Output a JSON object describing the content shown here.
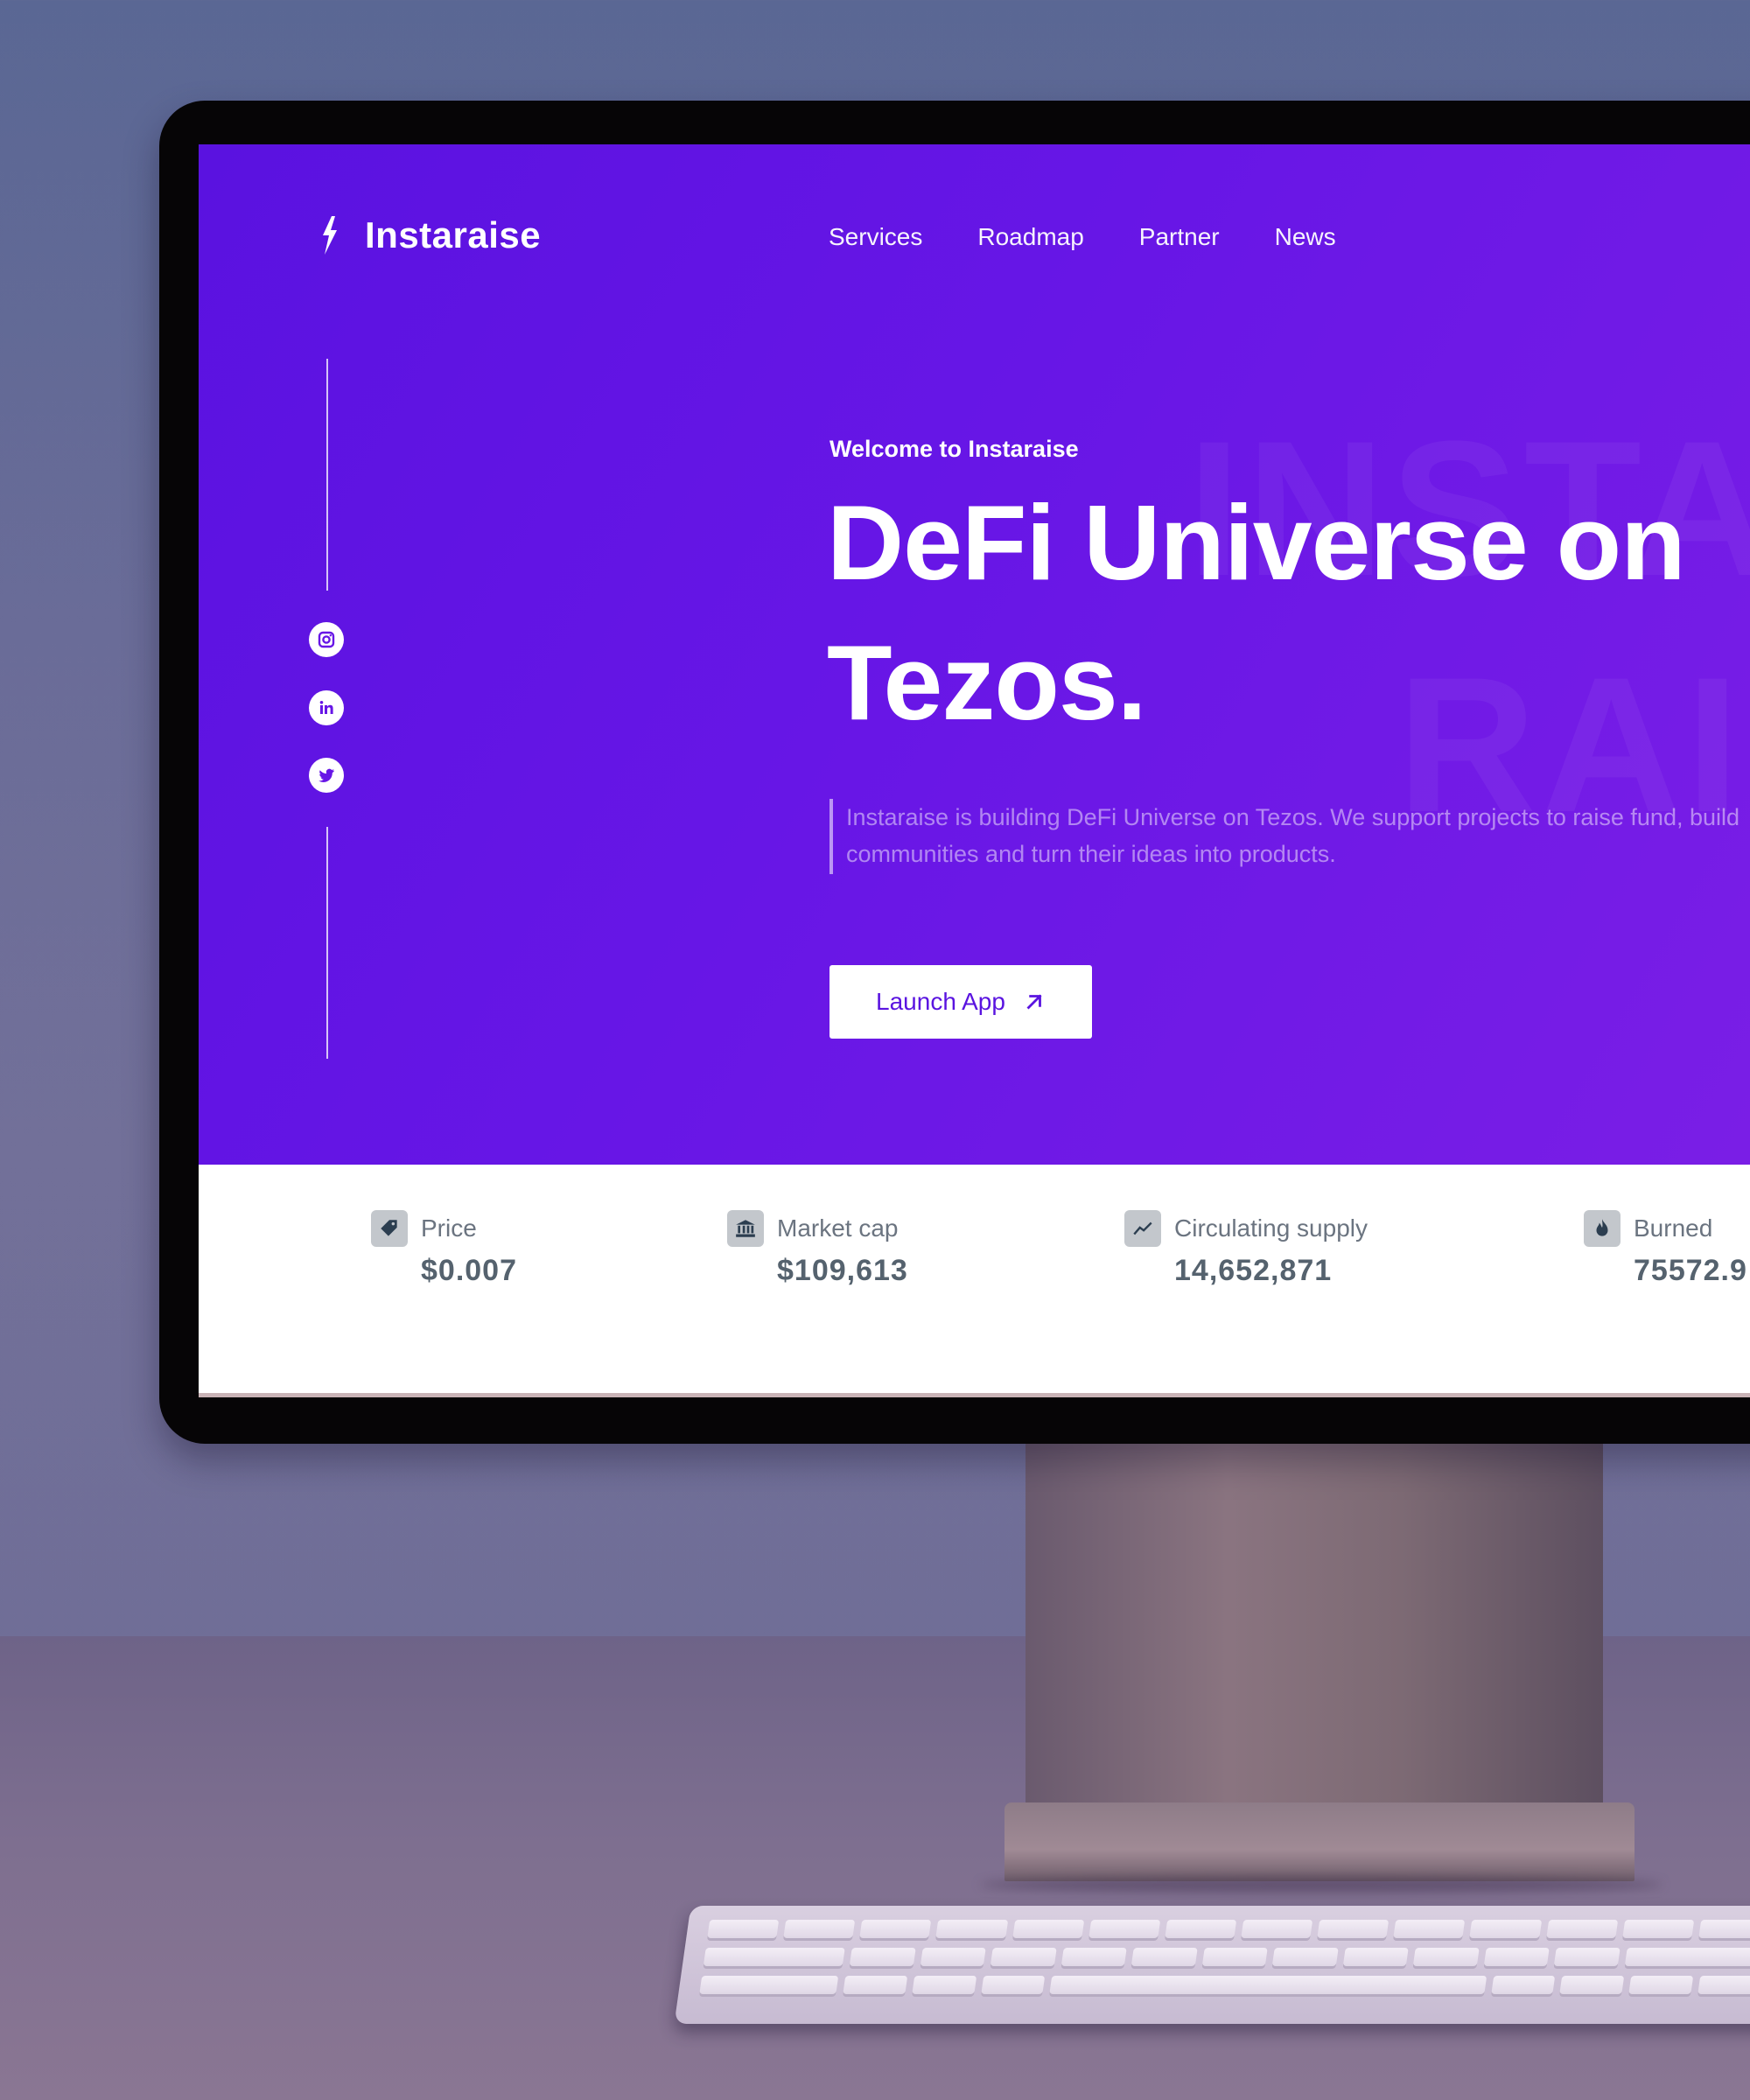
{
  "header": {
    "brand": "Instaraise",
    "nav": [
      "Services",
      "Roadmap",
      "Partner",
      "News"
    ]
  },
  "hero": {
    "welcome": "Welcome to Instaraise",
    "headline": "DeFi Universe on Tezos.",
    "watermark_top": "INSTA",
    "watermark_bottom": "RAISE",
    "description": "Instaraise is building DeFi Universe on Tezos. We support projects to raise fund, build communities and turn their ideas into products.",
    "cta_label": "Launch App"
  },
  "social": [
    "instagram-icon",
    "linkedin-icon",
    "twitter-icon"
  ],
  "stats": [
    {
      "icon": "price-tag-icon",
      "label": "Price",
      "value": "$0.007"
    },
    {
      "icon": "bank-icon",
      "label": "Market cap",
      "value": "$109,613"
    },
    {
      "icon": "trend-chart-icon",
      "label": "Circulating supply",
      "value": "14,652,871"
    },
    {
      "icon": "fire-icon",
      "label": "Burned",
      "value": "75572.9"
    }
  ],
  "colors": {
    "hero_start": "#5a12e0",
    "hero_end": "#7a1ee6",
    "cta_text": "#5a14e0",
    "stat_value": "#55626e"
  }
}
